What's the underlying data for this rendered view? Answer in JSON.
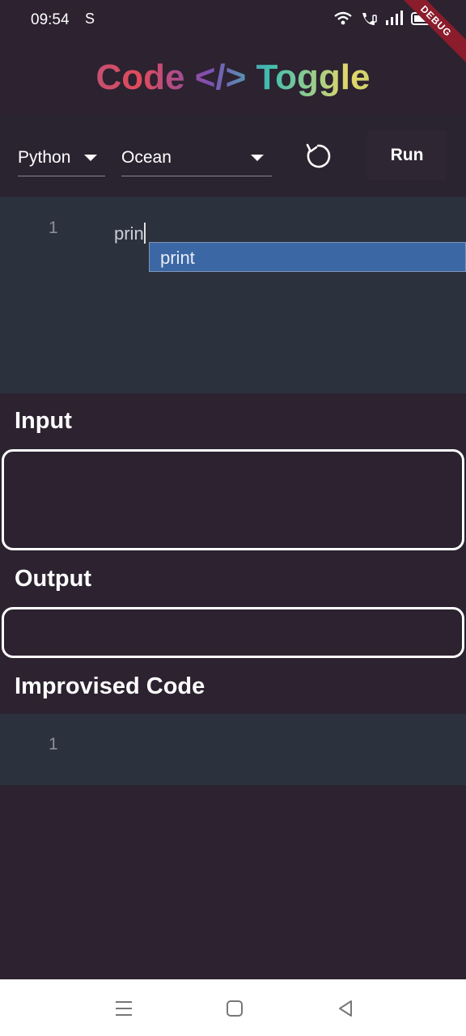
{
  "status": {
    "time": "09:54",
    "s_icon": "S"
  },
  "debug_banner": "DEBUG",
  "app_title": "Code </> Toggle",
  "toolbar": {
    "language": "Python",
    "theme": "Ocean",
    "run_label": "Run"
  },
  "editor": {
    "line_number": "1",
    "code": "prin",
    "suggestion": "print"
  },
  "sections": {
    "input_label": "Input",
    "output_label": "Output",
    "improvised_label": "Improvised Code"
  },
  "improvised_editor": {
    "line_number": "1"
  },
  "icons": {
    "wifi": "wifi-icon",
    "call": "wifi-call-icon",
    "signal": "signal-icon",
    "battery": "battery-icon",
    "reset": "reset-icon",
    "menu": "menu-icon",
    "home": "home-icon",
    "back": "back-icon"
  },
  "colors": {
    "background": "#2c2230",
    "editor_background": "#2b313d",
    "suggestion_highlight": "#3c67a5",
    "debug_ribbon": "#8a1c2c"
  }
}
